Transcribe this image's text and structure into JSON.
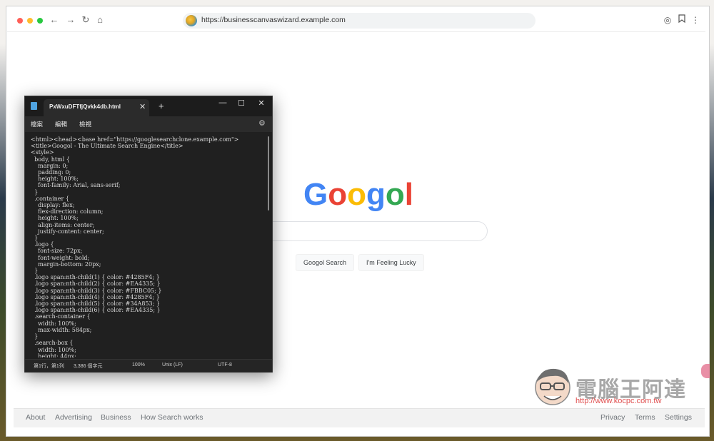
{
  "browser": {
    "url": "https://businesscanvaswizard.example.com",
    "icons": [
      "back-arrow-icon",
      "forward-arrow-icon",
      "reload-icon",
      "home-icon",
      "extensions-icon",
      "bookmark-icon",
      "more-menu-icon"
    ]
  },
  "page": {
    "logo": "Googol",
    "logo_colors": [
      "#4285F4",
      "#EA4335",
      "#FBBC05",
      "#4285F4",
      "#34A853",
      "#EA4335"
    ],
    "search_button": "Googol Search",
    "lucky_button": "I'm Feeling Lucky",
    "footer_left": [
      "About",
      "Advertising",
      "Business",
      "How Search works"
    ],
    "footer_right": [
      "Privacy",
      "Terms",
      "Settings"
    ]
  },
  "editor": {
    "tab_title": "PxWxuDFTfjQvkk4db.html",
    "new_tab": "+",
    "close": "✕",
    "menus": [
      "檔案",
      "編輯",
      "檢視"
    ],
    "code": "<html><head><base href=\"https://googlesearchclone.example.com\">\n<title>Googol - The Ultimate Search Engine</title>\n<style>\n  body, html {\n    margin: 0;\n    padding: 0;\n    height: 100%;\n    font-family: Arial, sans-serif;\n  }\n  .container {\n    display: flex;\n    flex-direction: column;\n    height: 100%;\n    align-items: center;\n    justify-content: center;\n  }\n  .logo {\n    font-size: 72px;\n    font-weight: bold;\n    margin-bottom: 20px;\n  }\n  .logo span:nth-child(1) { color: #4285F4; }\n  .logo span:nth-child(2) { color: #EA4335; }\n  .logo span:nth-child(3) { color: #FBBC05; }\n  .logo span:nth-child(4) { color: #4285F4; }\n  .logo span:nth-child(5) { color: #34A853; }\n  .logo span:nth-child(6) { color: #EA4335; }\n  .search-container {\n    width: 100%;\n    max-width: 584px;\n  }\n  .search-box {\n    width: 100%;\n    height: 44px;",
    "status": {
      "position": "第1行，第1列",
      "chars": "3,386 個字元",
      "zoom": "100%",
      "line_ending": "Unix (LF)",
      "encoding": "UTF-8"
    }
  },
  "watermark": {
    "title": "電腦王阿達",
    "url": "http://www.kocpc.com.tw"
  }
}
